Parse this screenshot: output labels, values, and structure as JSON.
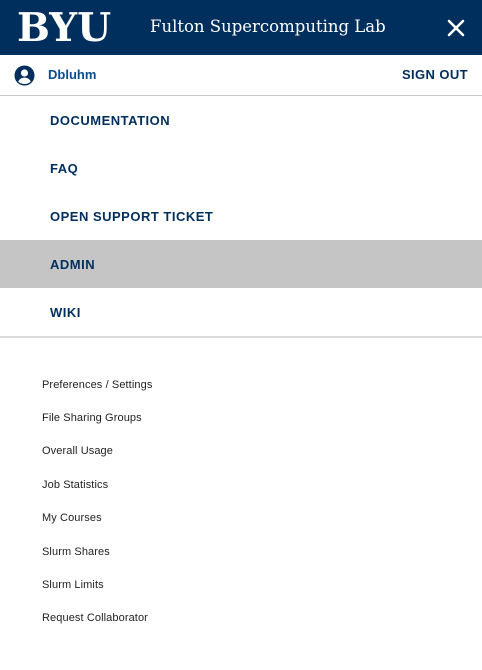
{
  "header": {
    "logo_text": "BYU",
    "title": "Fulton Supercomputing Lab",
    "close_icon": "close-icon",
    "background": "#002e5d"
  },
  "user": {
    "name": "Dbluhm",
    "icon": "user-circle-icon",
    "sign_out": "SIGN OUT"
  },
  "nav": {
    "items": [
      {
        "label": "DOCUMENTATION"
      },
      {
        "label": "FAQ"
      },
      {
        "label": "OPEN SUPPORT TICKET"
      },
      {
        "label": "ADMIN"
      },
      {
        "label": "WIKI"
      }
    ],
    "active": "ADMIN",
    "active_color": "#c5c5c5"
  },
  "submenu": {
    "items": [
      {
        "label": "Preferences / Settings"
      },
      {
        "label": "File Sharing Groups"
      },
      {
        "label": "Overall Usage"
      },
      {
        "label": "Job Statistics"
      },
      {
        "label": "My Courses"
      },
      {
        "label": "Slurm Shares"
      },
      {
        "label": "Slurm Limits"
      },
      {
        "label": "Request Collaborator"
      }
    ]
  }
}
